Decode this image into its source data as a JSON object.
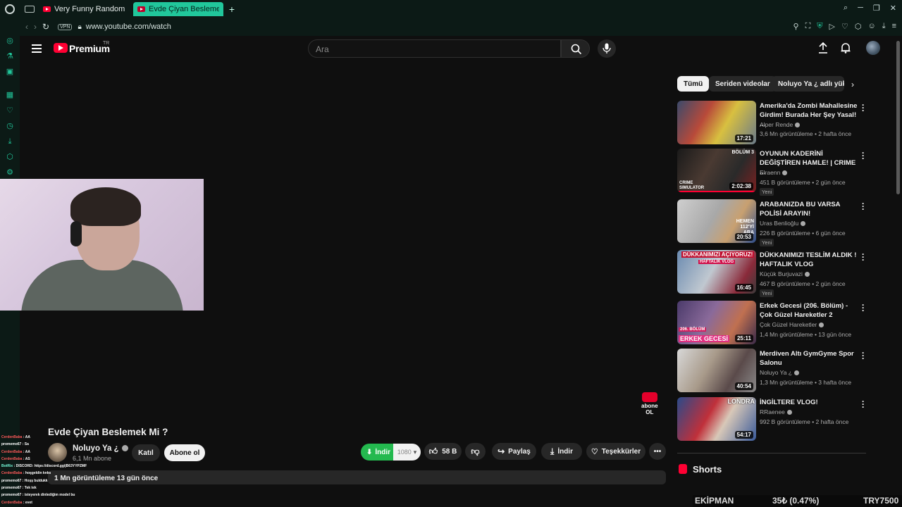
{
  "browser": {
    "tabs": [
      {
        "title": "Very Funny Random Mem",
        "active": false
      },
      {
        "title": "Evde Çiyan Beslemek Mi",
        "active": true
      }
    ],
    "new_tab": "+",
    "vpn_label": "VPN",
    "url": "www.youtube.com/watch"
  },
  "header": {
    "logo_text": "Premium",
    "region": "TR",
    "search_placeholder": "Ara"
  },
  "video": {
    "title": "Evde Çiyan Beslemek Mi ?",
    "channel_name": "Noluyo Ya ¿",
    "subscribers": "6,1 Mn abone",
    "join_label": "Katıl",
    "subscribe_label": "Abone ol",
    "download_green_label": "İndir",
    "resolution": "1080",
    "likes": "58 B",
    "share_label": "Paylaş",
    "download_label": "İndir",
    "thanks_label": "Teşekkürler",
    "description_summary": "1 Mn görüntüleme  13 gün önce",
    "watermark_line1": "abone",
    "watermark_line2": "OL"
  },
  "chat": [
    {
      "user": "CerdenBaba",
      "msg": "AA"
    },
    {
      "user": "promemo67",
      "msg": "Sa"
    },
    {
      "user": "CerdenBaba",
      "msg": "AA"
    },
    {
      "user": "CerdenBaba",
      "msg": "AS"
    },
    {
      "user": "BotRix",
      "msg": "DISCORD: https://discord.gg/jB63YYPZMF"
    },
    {
      "user": "CerdenBaba",
      "msg": "hoşgeldin knks"
    },
    {
      "user": "promemo67",
      "msg": "Hoşş buldukk"
    },
    {
      "user": "promemo67",
      "msg": "Tek tek"
    },
    {
      "user": "promemo67",
      "msg": "isteyerek dinlediğim model bu"
    },
    {
      "user": "CerdenBaba",
      "msg": "evet"
    }
  ],
  "chips": [
    "Tümü",
    "Seriden videolar",
    "Noluyo Ya ¿ adlı yükle"
  ],
  "recommendations": [
    {
      "title": "Amerika'da Zombi Mahallesine Girdim! Burada Her Şey Yasal! ...",
      "channel": "Alper Rende",
      "meta": "3,6 Mn görüntüleme • 2 hafta önce",
      "duration": "17:21",
      "new": ""
    },
    {
      "title": "OYUNUN KADERİNİ DEĞİŞTİREN HAMLE! | CRIME ...",
      "channel": "Elraenn",
      "meta": "451 B görüntüleme • 2 gün önce",
      "duration": "2:02:38",
      "new": "Yeni",
      "thumb_text": "BÖLÜM 3",
      "thumb_text2": "CRIME SIMULATOR"
    },
    {
      "title": "ARABANIZDA BU VARSA POLİSİ ARAYIN!",
      "channel": "Uras Benlioğlu",
      "meta": "226 B görüntüleme • 6 gün önce",
      "duration": "20:53",
      "new": "Yeni",
      "thumb_text": "HEMEN 112'Yİ ARA"
    },
    {
      "title": "DÜKKANIMIZI TESLİM ALDIK ! HAFTALIK VLOG",
      "channel": "Küçük Burjuvazi",
      "meta": "467 B görüntüleme • 2 gün önce",
      "duration": "16:45",
      "new": "Yeni",
      "thumb_text": "DÜKKANIMIZI AÇIYORUZ!",
      "thumb_text2": "HAFTALIK VLOG"
    },
    {
      "title": "Erkek Gecesi (206. Bölüm) - Çok Güzel Hareketler 2",
      "channel": "Çok Güzel Hareketler",
      "meta": "1,4 Mn görüntüleme • 13 gün önce",
      "duration": "25:11",
      "new": "",
      "thumb_text": "206. BÖLÜM",
      "thumb_text2": "ERKEK GECESİ"
    },
    {
      "title": "Merdiven Altı GymGyme Spor Salonu",
      "channel": "Noluyo Ya ¿",
      "meta": "1,3 Mn görüntüleme • 3 hafta önce",
      "duration": "40:54",
      "new": ""
    },
    {
      "title": "İNGİLTERE VLOG!",
      "channel": "RRaenee",
      "meta": "992 B görüntüleme • 2 hafta önce",
      "duration": "54:17",
      "new": "",
      "thumb_text": "LONDRA"
    }
  ],
  "shorts_header": "Shorts",
  "ticker": {
    "label": "EKİPMAN",
    "change": "35₺ (0.47%)",
    "price": "TRY7500"
  },
  "colors": {
    "accent": "#21c79b",
    "youtube_red": "#ff0033",
    "download_green": "#24b94f",
    "background": "#0f0f0f"
  }
}
